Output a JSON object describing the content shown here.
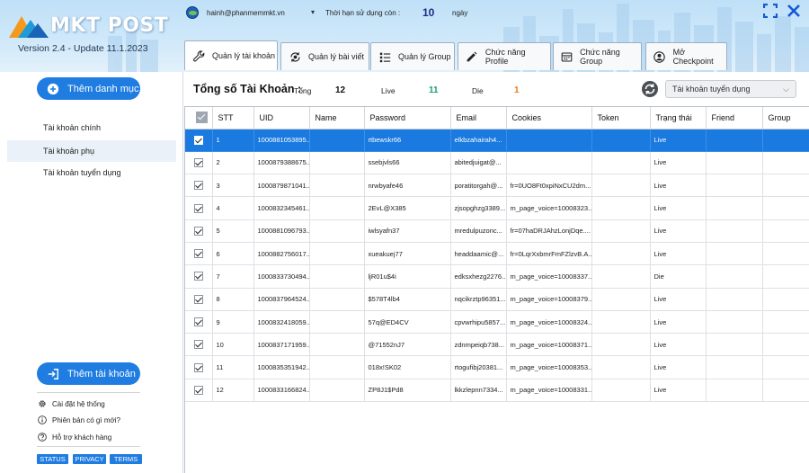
{
  "app": {
    "logo_text": "MKT POST",
    "version": "Version 2.4 - Update 11.1.2023"
  },
  "user": {
    "email": "hainh@phanmemmkt.vn",
    "expiry_label": "Thời hạn sử dụng còn :",
    "expiry_value": "10",
    "expiry_unit": "ngày"
  },
  "tabs": [
    {
      "label": "Quản lý tài khoản",
      "icon": "wrench-icon",
      "active": true
    },
    {
      "label": "Quản lý bài viết",
      "icon": "sync-icon",
      "active": false
    },
    {
      "label": "Quản lý Group",
      "icon": "list-icon",
      "active": false
    },
    {
      "label": "Chức năng Profile",
      "icon": "pencil-icon",
      "active": false
    },
    {
      "label": "Chức năng Group",
      "icon": "calendar-icon",
      "active": false
    },
    {
      "label": "Mở Checkpoint",
      "icon": "user-circle-icon",
      "active": false
    }
  ],
  "sidebar": {
    "add_category_label": "Thêm danh mục",
    "items": [
      {
        "label": "Tài khoản chính",
        "active": false
      },
      {
        "label": "Tài khoản phụ",
        "active": true
      },
      {
        "label": "Tài khoản tuyển dụng",
        "active": false
      }
    ],
    "add_account_label": "Thêm tài khoản",
    "menu": [
      {
        "label": "Cài đặt hệ thống",
        "icon": "gear-icon"
      },
      {
        "label": "Phiên bản có gì mới?",
        "icon": "info-icon"
      },
      {
        "label": "Hỗ trợ khách hàng",
        "icon": "help-icon"
      }
    ],
    "chips": [
      "STATUS",
      "PRIVACY",
      "TERMS"
    ]
  },
  "summary": {
    "title": "Tổng số Tài Khoản :",
    "total_label": "Tổng",
    "total_value": "12",
    "live_label": "Live",
    "live_value": "11",
    "die_label": "Die",
    "die_value": "1",
    "colors": {
      "live": "#1aa36a",
      "die": "#e8791d"
    },
    "category_select": "Tài khoản tuyển dụng"
  },
  "table": {
    "columns": [
      "",
      "STT",
      "UID",
      "Name",
      "Password",
      "Email",
      "Cookies",
      "Token",
      "Trạng thái",
      "Friend",
      "Group"
    ],
    "rows": [
      {
        "stt": "1",
        "uid": "1000881053895...",
        "name": "",
        "password": "rtbewskr66",
        "email": "elkbzahairah4...",
        "cookies": "",
        "token": "",
        "status": "Live",
        "friend": "",
        "group": "",
        "selected": true
      },
      {
        "stt": "2",
        "uid": "1000879388675...",
        "name": "",
        "password": "ssebjvls66",
        "email": "abitedjuigat@...",
        "cookies": "",
        "token": "",
        "status": "Live",
        "friend": "",
        "group": "",
        "selected": false
      },
      {
        "stt": "3",
        "uid": "1000879871041...",
        "name": "",
        "password": "nrwbyafe46",
        "email": "poratitorgah@...",
        "cookies": "fr=0UO8Ft0xpiNxCU2dm....",
        "token": "",
        "status": "Live",
        "friend": "",
        "group": "",
        "selected": false
      },
      {
        "stt": "4",
        "uid": "1000832345461...",
        "name": "",
        "password": "2EvL@X385",
        "email": "zjsopghzg3389...",
        "cookies": "m_page_voice=10008323...",
        "token": "",
        "status": "Live",
        "friend": "",
        "group": "",
        "selected": false
      },
      {
        "stt": "5",
        "uid": "1000881096793...",
        "name": "",
        "password": "iwlsyafn37",
        "email": "mredulpuzonc...",
        "cookies": "fr=07haDRJAhzLonjDqe....",
        "token": "",
        "status": "Live",
        "friend": "",
        "group": "",
        "selected": false
      },
      {
        "stt": "6",
        "uid": "1000882756017...",
        "name": "",
        "password": "xueakuej77",
        "email": "headdaamic@...",
        "cookies": "fr=0LqrXxbmrFmFZlzvB.A...",
        "token": "",
        "status": "Live",
        "friend": "",
        "group": "",
        "selected": false
      },
      {
        "stt": "7",
        "uid": "1000833730494...",
        "name": "",
        "password": "ljR01u$4i",
        "email": "edksxhezg2276...",
        "cookies": "m_page_voice=10008337...",
        "token": "",
        "status": "Die",
        "friend": "",
        "group": "",
        "selected": false
      },
      {
        "stt": "8",
        "uid": "1000837964524...",
        "name": "",
        "password": "$578T4lb4",
        "email": "nqcikrztp96351...",
        "cookies": "m_page_voice=10008379...",
        "token": "",
        "status": "Live",
        "friend": "",
        "group": "",
        "selected": false
      },
      {
        "stt": "9",
        "uid": "1000832418059...",
        "name": "",
        "password": "57q@ED4CV",
        "email": "cpvwrhipu5857...",
        "cookies": "m_page_voice=10008324...",
        "token": "",
        "status": "Live",
        "friend": "",
        "group": "",
        "selected": false
      },
      {
        "stt": "10",
        "uid": "1000837171959...",
        "name": "",
        "password": "@71552nJ7",
        "email": "zdnmpeiqb738...",
        "cookies": "m_page_voice=10008371...",
        "token": "",
        "status": "Live",
        "friend": "",
        "group": "",
        "selected": false
      },
      {
        "stt": "11",
        "uid": "1000835351942...",
        "name": "",
        "password": "018x!SK02",
        "email": "rtogufibj20381...",
        "cookies": "m_page_voice=10008353...",
        "token": "",
        "status": "Live",
        "friend": "",
        "group": "",
        "selected": false
      },
      {
        "stt": "12",
        "uid": "1000833166824...",
        "name": "",
        "password": "ZP8J1$Pd8",
        "email": "lkkzlepnn7334...",
        "cookies": "m_page_voice=10008331...",
        "token": "",
        "status": "Live",
        "friend": "",
        "group": "",
        "selected": false
      }
    ]
  },
  "theme": {
    "accent": "#1f7ce0",
    "selected_row": "#1b7ae0",
    "expiry_color": "#1a2c86"
  }
}
